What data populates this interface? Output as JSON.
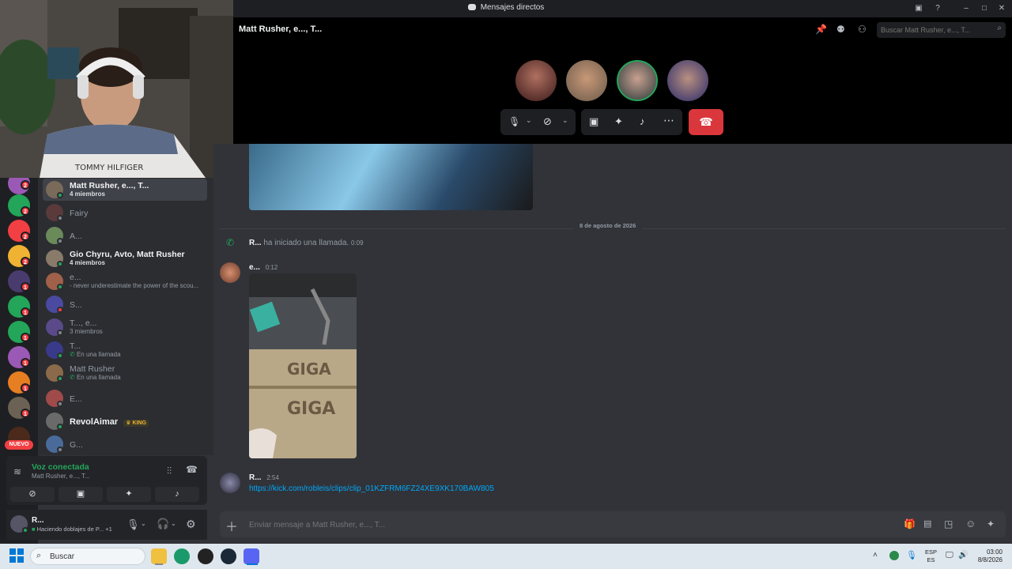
{
  "window": {
    "title": "Mensajes directos"
  },
  "header": {
    "channel_title": "Matt Rusher, e..., T...",
    "search_placeholder": "Buscar Matt Rusher, e..., T..."
  },
  "guild_badges": [
    "2",
    "2",
    "2",
    "2",
    "1",
    "1",
    "1",
    "1",
    "1",
    "1"
  ],
  "new_badge": "NUEVO",
  "dms": [
    {
      "name": "Matt Rusher, e..., T...",
      "sub": "4 miembros",
      "selected": true
    },
    {
      "name": "Fairy",
      "sub": ""
    },
    {
      "name": "A...",
      "sub": ""
    },
    {
      "name": "Gio Chyru, Avto, Matt Rusher",
      "sub": "4 miembros"
    },
    {
      "name": "e...",
      "sub": "- never underestimate the power of the scou..."
    },
    {
      "name": "S...",
      "sub": ""
    },
    {
      "name": "T..., e...",
      "sub": "3 miembros"
    },
    {
      "name": "T...",
      "sub": "En una llamada"
    },
    {
      "name": "Matt Rusher",
      "sub": "En una llamada"
    },
    {
      "name": "E...",
      "sub": ""
    },
    {
      "name": "RevolAimar",
      "sub": "",
      "tag": "KING"
    },
    {
      "name": "G...",
      "sub": ""
    }
  ],
  "voice": {
    "status": "Voz conectada",
    "channel": "Matt Rusher, e..., T..."
  },
  "user": {
    "name": "R...",
    "activity": "Haciendo doblajes de P...",
    "extra": "+1"
  },
  "chat": {
    "date_divider": "8 de agosto de 2026",
    "call_event": {
      "author": "R...",
      "text": "ha iniciado una llamada.",
      "time": "0:09"
    },
    "msg1": {
      "author": "e...",
      "time": "0:12"
    },
    "msg2": {
      "author": "R...",
      "time": "2:54",
      "link": "https://kick.com/robleis/clips/clip_01KZFRM6FZ24XE9XK170BAW805"
    },
    "composer_placeholder": "Enviar mensaje a Matt Rusher, e..., T..."
  },
  "taskbar": {
    "search_placeholder": "Buscar",
    "lang1": "ESP",
    "lang2": "ES",
    "time": "03:00",
    "date": "8/8/2026"
  },
  "colors": {
    "accent": "#5865f2",
    "online": "#23a55a",
    "hangup": "#da373c",
    "link": "#00a8fc"
  }
}
